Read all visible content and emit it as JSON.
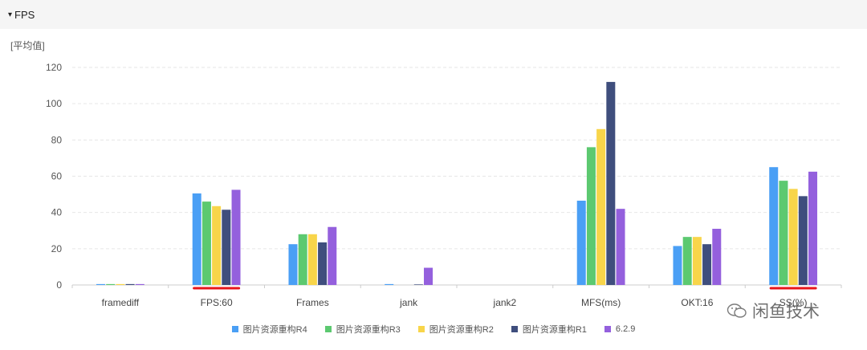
{
  "header": {
    "caret": "▾",
    "title": "FPS"
  },
  "unit_label": "[平均值]",
  "watermark": {
    "text": "闲鱼技术",
    "icon": "wechat-icon"
  },
  "colors": {
    "grid": "#e6e6e6",
    "axis": "#cccccc",
    "underline": "#e8161b"
  },
  "chart_data": {
    "type": "bar",
    "categories": [
      "framediff",
      "FPS:60",
      "Frames",
      "jank",
      "jank2",
      "MFS(ms)",
      "OKT:16",
      "SS(%)"
    ],
    "ylim": [
      0,
      120
    ],
    "yticks": [
      0,
      20,
      40,
      60,
      80,
      100,
      120
    ],
    "grid": true,
    "legend": "bottom",
    "series": [
      {
        "name": "图片资源重构R4",
        "color": "#4a9ff5",
        "values": [
          0.5,
          50.5,
          22.5,
          0.5,
          0,
          46.5,
          21.5,
          65
        ]
      },
      {
        "name": "图片资源重构R3",
        "color": "#5cc970",
        "values": [
          0.5,
          46,
          28,
          0,
          0,
          76,
          26.5,
          57.5
        ]
      },
      {
        "name": "图片资源重构R2",
        "color": "#f8d54a",
        "values": [
          0.5,
          43.5,
          28,
          0,
          0,
          86,
          26.5,
          53
        ]
      },
      {
        "name": "图片资源重构R1",
        "color": "#3f4e7d",
        "values": [
          0.5,
          41.5,
          23.5,
          0.3,
          0,
          112,
          22.5,
          49
        ]
      },
      {
        "name": "6.2.9",
        "color": "#9460dd",
        "values": [
          0.5,
          52.5,
          32,
          9.5,
          0,
          42,
          31,
          62.5
        ]
      }
    ],
    "highlighted_categories": [
      "FPS:60",
      "SS(%)"
    ]
  }
}
